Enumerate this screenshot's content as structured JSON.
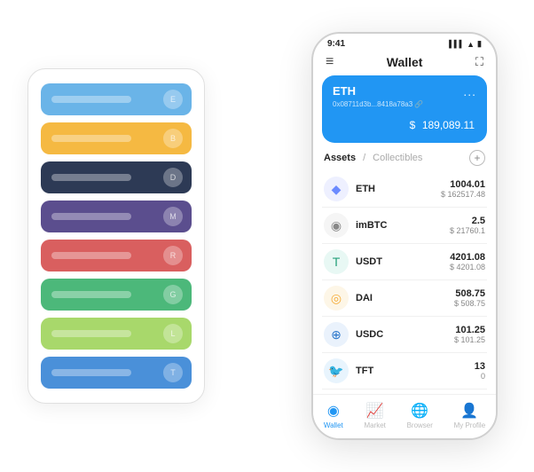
{
  "scene": {
    "card_stack": {
      "cards": [
        {
          "color": "#6AB4E8",
          "dot": "E"
        },
        {
          "color": "#F5B942",
          "dot": "B"
        },
        {
          "color": "#2D3A55",
          "dot": "D"
        },
        {
          "color": "#5B4E8E",
          "dot": "M"
        },
        {
          "color": "#D95F5F",
          "dot": "R"
        },
        {
          "color": "#4CB87A",
          "dot": "G"
        },
        {
          "color": "#A8D86B",
          "dot": "L"
        },
        {
          "color": "#4A90D9",
          "dot": "T"
        }
      ]
    },
    "phone": {
      "status_bar": {
        "time": "9:41",
        "signal": "▌▌▌",
        "wifi": "▲",
        "battery": "▬"
      },
      "header": {
        "menu_icon": "≡",
        "title": "Wallet",
        "expand_icon": "⛶"
      },
      "eth_card": {
        "label": "ETH",
        "address": "0x08711d3b...8418a78a3",
        "address_suffix": "🔗",
        "more": "...",
        "currency": "$",
        "balance": "189,089.11"
      },
      "tabs": {
        "active": "Assets",
        "separator": "/",
        "inactive": "Collectibles"
      },
      "assets": [
        {
          "name": "ETH",
          "amount": "1004.01",
          "usd": "$ 162517.48",
          "icon": "♦",
          "icon_color": "#6B8AFF",
          "bg_color": "#EEF0FF"
        },
        {
          "name": "imBTC",
          "amount": "2.5",
          "usd": "$ 21760.1",
          "icon": "⊙",
          "icon_color": "#888",
          "bg_color": "#F5F5F5"
        },
        {
          "name": "USDT",
          "amount": "4201.08",
          "usd": "$ 4201.08",
          "icon": "T",
          "icon_color": "#26A17B",
          "bg_color": "#E8F8F4"
        },
        {
          "name": "DAI",
          "amount": "508.75",
          "usd": "$ 508.75",
          "icon": "◎",
          "icon_color": "#F5AC37",
          "bg_color": "#FDF6E7"
        },
        {
          "name": "USDC",
          "amount": "101.25",
          "usd": "$ 101.25",
          "icon": "⊕",
          "icon_color": "#2775CA",
          "bg_color": "#EAF2FC"
        },
        {
          "name": "TFT",
          "amount": "13",
          "usd": "0",
          "icon": "🐦",
          "icon_color": "#1DA1F2",
          "bg_color": "#E8F4FD"
        }
      ],
      "bottom_nav": [
        {
          "label": "Wallet",
          "icon": "◉",
          "active": true
        },
        {
          "label": "Market",
          "icon": "📊",
          "active": false
        },
        {
          "label": "Browser",
          "icon": "👥",
          "active": false
        },
        {
          "label": "My Profile",
          "icon": "👤",
          "active": false
        }
      ]
    }
  }
}
